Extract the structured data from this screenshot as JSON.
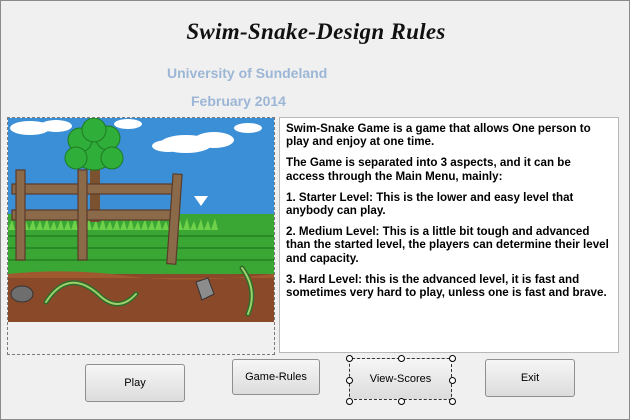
{
  "form": {
    "title": "Swim-Snake-Design Rules",
    "university": "University of Sundeland",
    "date": "February 2014"
  },
  "rules": {
    "paragraphs": [
      "Swim-Snake Game is a game that allows One person to play and enjoy at one time.",
      "The Game is separated into 3 aspects, and it can be access through the Main Menu, mainly:",
      "1. Starter Level: This is the lower and easy level that anybody can play.",
      "2. Medium Level: This is a little bit tough and advanced than the started level, the players can determine their level and capacity.",
      "3. Hard Level: this is the advanced level, it is fast and sometimes very hard to play, unless one is fast and brave."
    ]
  },
  "buttons": {
    "play": "Play",
    "game_rules": "Game-Rules",
    "view_scores": "View-Scores",
    "exit": "Exit"
  },
  "colors": {
    "subtitle": "#9cb6d6",
    "sky": "#3a8fd6",
    "grass": "#3aa634",
    "ground": "#8a4a2a",
    "fence": "#8b6a4a"
  }
}
